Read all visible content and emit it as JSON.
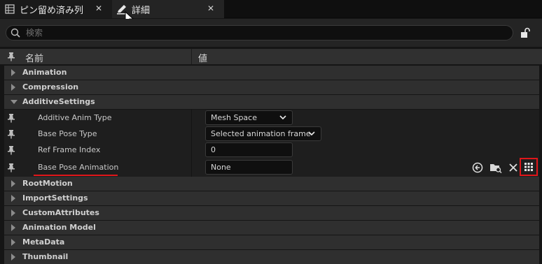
{
  "tabs": [
    {
      "label": "ピン留め済み列",
      "icon": "grid-list-icon"
    },
    {
      "label": "詳細",
      "icon": "pencil-icon"
    }
  ],
  "tab_close_glyph": "✕",
  "search": {
    "placeholder": "検索",
    "value": ""
  },
  "header": {
    "name_col": "名前",
    "value_col": "値"
  },
  "categories_top": [
    {
      "label": "Animation",
      "expanded": false
    },
    {
      "label": "Compression",
      "expanded": false
    },
    {
      "label": "AdditiveSettings",
      "expanded": true
    }
  ],
  "properties": [
    {
      "name": "Additive Anim Type",
      "value": "Mesh Space",
      "kind": "combo"
    },
    {
      "name": "Base Pose Type",
      "value": "Selected animation frame",
      "kind": "combo"
    },
    {
      "name": "Ref Frame Index",
      "value": "0",
      "kind": "number"
    },
    {
      "name": "Base Pose Animation",
      "value": "None",
      "kind": "asset"
    }
  ],
  "asset_actions": [
    "use-selected-icon",
    "browse-asset-icon",
    "clear-icon",
    "picker-grid-icon"
  ],
  "categories_bottom": [
    {
      "label": "RootMotion"
    },
    {
      "label": "ImportSettings"
    },
    {
      "label": "CustomAttributes"
    },
    {
      "label": "Animation Model"
    },
    {
      "label": "MetaData"
    },
    {
      "label": "Thumbnail"
    }
  ],
  "colors": {
    "highlight": "#e0161a",
    "panel": "#242424",
    "category": "#2f2f2f"
  }
}
